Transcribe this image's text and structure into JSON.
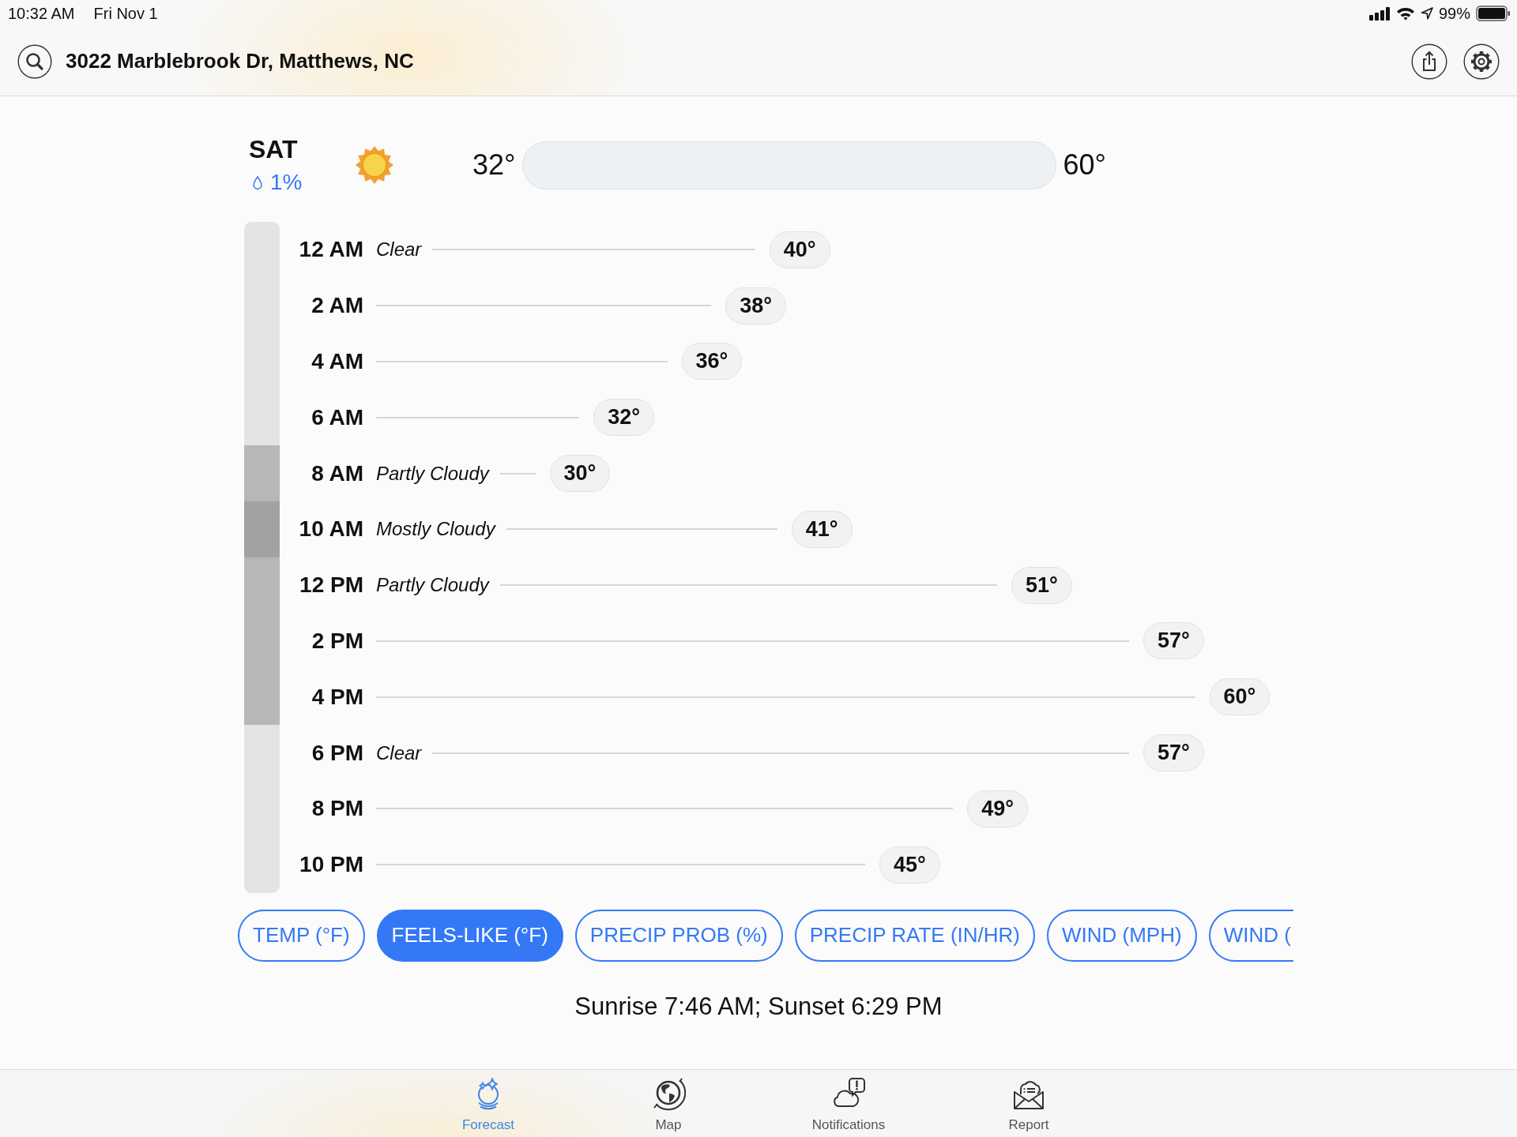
{
  "status_bar": {
    "time": "10:32 AM",
    "date": "Fri Nov 1",
    "battery": "99%"
  },
  "header": {
    "address": "3022 Marblebrook Dr, Matthews, NC"
  },
  "day": {
    "name": "SAT",
    "precip": "1%",
    "low": "32°",
    "high": "60°"
  },
  "hours": [
    {
      "time": "12 AM",
      "condition": "Clear",
      "temp": "40°",
      "color": "#e4e4e4"
    },
    {
      "time": "2 AM",
      "temp": "38°",
      "color": "#e4e4e4"
    },
    {
      "time": "4 AM",
      "temp": "36°",
      "color": "#e4e4e4"
    },
    {
      "time": "6 AM",
      "temp": "32°",
      "color": "#e4e4e4"
    },
    {
      "time": "8 AM",
      "condition": "Partly Cloudy",
      "temp": "30°",
      "color": "#b7b7b7"
    },
    {
      "time": "10 AM",
      "condition": "Mostly Cloudy",
      "temp": "41°",
      "color": "#a2a2a2"
    },
    {
      "time": "12 PM",
      "condition": "Partly Cloudy",
      "temp": "51°",
      "color": "#b7b7b7"
    },
    {
      "time": "2 PM",
      "temp": "57°",
      "color": "#b7b7b7"
    },
    {
      "time": "4 PM",
      "temp": "60°",
      "color": "#b7b7b7"
    },
    {
      "time": "6 PM",
      "condition": "Clear",
      "temp": "57°",
      "color": "#e4e4e4"
    },
    {
      "time": "8 PM",
      "temp": "49°",
      "color": "#e4e4e4"
    },
    {
      "time": "10 PM",
      "temp": "45°",
      "color": "#e4e4e4"
    }
  ],
  "metrics": [
    {
      "label": "TEMP (°F)",
      "selected": false,
      "kind": "full"
    },
    {
      "label": "FEELS-LIKE (°F)",
      "selected": true,
      "kind": "full"
    },
    {
      "label": "PRECIP PROB (%)",
      "selected": false,
      "kind": "full"
    },
    {
      "label": "PRECIP RATE (IN/HR)",
      "selected": false,
      "kind": "full"
    },
    {
      "label": "WIND (MPH)",
      "selected": false,
      "kind": "full"
    },
    {
      "label": "WIND (",
      "selected": false,
      "kind": "clipped"
    }
  ],
  "sun_times": "Sunrise 7:46 AM; Sunset 6:29 PM",
  "tabs": [
    {
      "label": "Forecast",
      "selected": true
    },
    {
      "label": "Map",
      "selected": false
    },
    {
      "label": "Notifications",
      "selected": false
    },
    {
      "label": "Report",
      "selected": false
    }
  ]
}
